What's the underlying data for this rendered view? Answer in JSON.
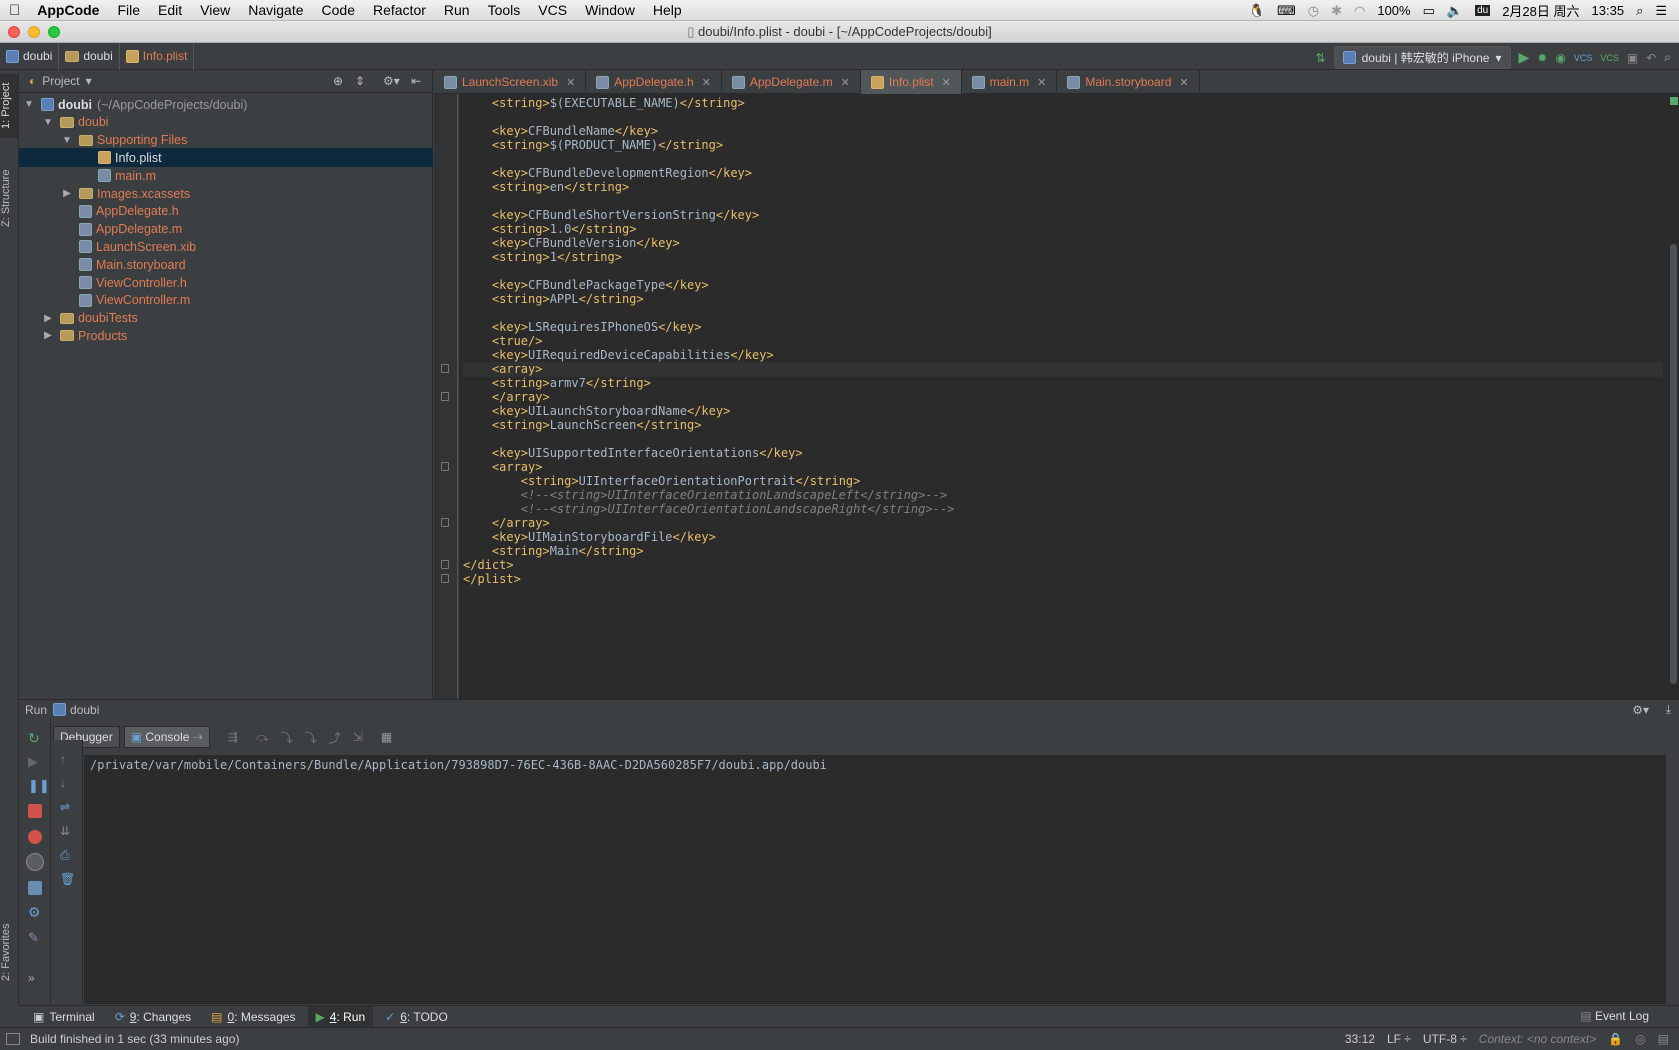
{
  "menubar": {
    "app": "AppCode",
    "items": [
      "File",
      "Edit",
      "View",
      "Navigate",
      "Code",
      "Refactor",
      "Run",
      "Tools",
      "VCS",
      "Window",
      "Help"
    ],
    "battery": "100%",
    "date": "2月28日 周六",
    "time": "13:35"
  },
  "window_title": "doubi/Info.plist - doubi - [~/AppCodeProjects/doubi]",
  "breadcrumbs": [
    "doubi",
    "doubi",
    "Info.plist"
  ],
  "run_config": "doubi | 韩宏敏的 iPhone",
  "vcs_labels": [
    "VCS",
    "VCS"
  ],
  "left_strip": {
    "project": "1: Project",
    "structure": "Z: Structure",
    "favorites": "2: Favorites"
  },
  "project_panel": {
    "header": "Project",
    "tree": [
      {
        "label": "doubi",
        "extra": "(~/AppCodeProjects/doubi)",
        "level": 0,
        "arrow": "▼",
        "icon": "proj",
        "color": "white"
      },
      {
        "label": "doubi",
        "level": 1,
        "arrow": "▼",
        "icon": "folder",
        "color": "orange"
      },
      {
        "label": "Supporting Files",
        "level": 2,
        "arrow": "▼",
        "icon": "folder",
        "color": "orange"
      },
      {
        "label": "Info.plist",
        "level": 3,
        "arrow": "",
        "icon": "plist",
        "color": "white",
        "selected": true
      },
      {
        "label": "main.m",
        "level": 3,
        "arrow": "",
        "icon": "m",
        "color": "orange"
      },
      {
        "label": "Images.xcassets",
        "level": 2,
        "arrow": "▶",
        "icon": "folder",
        "color": "orange"
      },
      {
        "label": "AppDelegate.h",
        "level": 2,
        "arrow": "",
        "icon": "m",
        "color": "orange"
      },
      {
        "label": "AppDelegate.m",
        "level": 2,
        "arrow": "",
        "icon": "m",
        "color": "orange"
      },
      {
        "label": "LaunchScreen.xib",
        "level": 2,
        "arrow": "",
        "icon": "m",
        "color": "orange"
      },
      {
        "label": "Main.storyboard",
        "level": 2,
        "arrow": "",
        "icon": "m",
        "color": "orange"
      },
      {
        "label": "ViewController.h",
        "level": 2,
        "arrow": "",
        "icon": "m",
        "color": "orange"
      },
      {
        "label": "ViewController.m",
        "level": 2,
        "arrow": "",
        "icon": "m",
        "color": "orange"
      },
      {
        "label": "doubiTests",
        "level": 1,
        "arrow": "▶",
        "icon": "folder",
        "color": "orange"
      },
      {
        "label": "Products",
        "level": 1,
        "arrow": "▶",
        "icon": "folder",
        "color": "orange"
      }
    ]
  },
  "editor_tabs": [
    {
      "label": "LaunchScreen.xib",
      "active": false
    },
    {
      "label": "AppDelegate.h",
      "active": false
    },
    {
      "label": "AppDelegate.m",
      "active": false
    },
    {
      "label": "Info.plist",
      "active": true
    },
    {
      "label": "main.m",
      "active": false
    },
    {
      "label": "Main.storyboard",
      "active": false
    }
  ],
  "code_lines": [
    {
      "indent": 1,
      "parts": [
        [
          "tag",
          "<string>"
        ],
        [
          "txt",
          "$(EXECUTABLE_NAME)"
        ],
        [
          "tag",
          "</string>"
        ]
      ]
    },
    {
      "indent": 0,
      "parts": []
    },
    {
      "indent": 1,
      "parts": [
        [
          "tag",
          "<key>"
        ],
        [
          "txt",
          "CFBundleName"
        ],
        [
          "tag",
          "</key>"
        ]
      ]
    },
    {
      "indent": 1,
      "parts": [
        [
          "tag",
          "<string>"
        ],
        [
          "txt",
          "$(PRODUCT_NAME)"
        ],
        [
          "tag",
          "</string>"
        ]
      ]
    },
    {
      "indent": 0,
      "parts": []
    },
    {
      "indent": 1,
      "parts": [
        [
          "tag",
          "<key>"
        ],
        [
          "txt",
          "CFBundleDevelopmentRegion"
        ],
        [
          "tag",
          "</key>"
        ]
      ]
    },
    {
      "indent": 1,
      "parts": [
        [
          "tag",
          "<string>"
        ],
        [
          "txt",
          "en"
        ],
        [
          "tag",
          "</string>"
        ]
      ]
    },
    {
      "indent": 0,
      "parts": []
    },
    {
      "indent": 1,
      "parts": [
        [
          "tag",
          "<key>"
        ],
        [
          "txt",
          "CFBundleShortVersionString"
        ],
        [
          "tag",
          "</key>"
        ]
      ]
    },
    {
      "indent": 1,
      "parts": [
        [
          "tag",
          "<string>"
        ],
        [
          "txt",
          "1.0"
        ],
        [
          "tag",
          "</string>"
        ]
      ]
    },
    {
      "indent": 1,
      "parts": [
        [
          "tag",
          "<key>"
        ],
        [
          "txt",
          "CFBundleVersion"
        ],
        [
          "tag",
          "</key>"
        ]
      ]
    },
    {
      "indent": 1,
      "parts": [
        [
          "tag",
          "<string>"
        ],
        [
          "txt",
          "1"
        ],
        [
          "tag",
          "</string>"
        ]
      ]
    },
    {
      "indent": 0,
      "parts": []
    },
    {
      "indent": 1,
      "parts": [
        [
          "tag",
          "<key>"
        ],
        [
          "txt",
          "CFBundlePackageType"
        ],
        [
          "tag",
          "</key>"
        ]
      ]
    },
    {
      "indent": 1,
      "parts": [
        [
          "tag",
          "<string>"
        ],
        [
          "txt",
          "APPL"
        ],
        [
          "tag",
          "</string>"
        ]
      ]
    },
    {
      "indent": 0,
      "parts": []
    },
    {
      "indent": 1,
      "parts": [
        [
          "tag",
          "<key>"
        ],
        [
          "txt",
          "LSRequiresIPhoneOS"
        ],
        [
          "tag",
          "</key>"
        ]
      ]
    },
    {
      "indent": 1,
      "parts": [
        [
          "tag",
          "<true/>"
        ]
      ]
    },
    {
      "indent": 1,
      "parts": [
        [
          "tag",
          "<key>"
        ],
        [
          "txt",
          "UIRequiredDeviceCapabilities"
        ],
        [
          "tag",
          "</key>"
        ]
      ]
    },
    {
      "indent": 1,
      "parts": [
        [
          "tag",
          "<array>"
        ]
      ],
      "highlight": true
    },
    {
      "indent": 1,
      "parts": [
        [
          "tag",
          "<string>"
        ],
        [
          "txt",
          "armv7"
        ],
        [
          "tag",
          "</string>"
        ]
      ]
    },
    {
      "indent": 1,
      "parts": [
        [
          "tag",
          "</array>"
        ]
      ]
    },
    {
      "indent": 1,
      "parts": [
        [
          "tag",
          "<key>"
        ],
        [
          "txt",
          "UILaunchStoryboardName"
        ],
        [
          "tag",
          "</key>"
        ]
      ]
    },
    {
      "indent": 1,
      "parts": [
        [
          "tag",
          "<string>"
        ],
        [
          "txt",
          "LaunchScreen"
        ],
        [
          "tag",
          "</string>"
        ]
      ]
    },
    {
      "indent": 0,
      "parts": []
    },
    {
      "indent": 1,
      "parts": [
        [
          "tag",
          "<key>"
        ],
        [
          "txt",
          "UISupportedInterfaceOrientations"
        ],
        [
          "tag",
          "</key>"
        ]
      ]
    },
    {
      "indent": 1,
      "parts": [
        [
          "tag",
          "<array>"
        ]
      ]
    },
    {
      "indent": 2,
      "parts": [
        [
          "tag",
          "<string>"
        ],
        [
          "txt",
          "UIInterfaceOrientationPortrait"
        ],
        [
          "tag",
          "</string>"
        ]
      ]
    },
    {
      "indent": 2,
      "parts": [
        [
          "cmt",
          "<!--<string>UIInterfaceOrientationLandscapeLeft</string>-->"
        ]
      ]
    },
    {
      "indent": 2,
      "parts": [
        [
          "cmt",
          "<!--<string>UIInterfaceOrientationLandscapeRight</string>-->"
        ]
      ]
    },
    {
      "indent": 1,
      "parts": [
        [
          "tag",
          "</array>"
        ]
      ]
    },
    {
      "indent": 1,
      "parts": [
        [
          "tag",
          "<key>"
        ],
        [
          "txt",
          "UIMainStoryboardFile"
        ],
        [
          "tag",
          "</key>"
        ]
      ]
    },
    {
      "indent": 1,
      "parts": [
        [
          "tag",
          "<string>"
        ],
        [
          "txt",
          "Main"
        ],
        [
          "tag",
          "</string>"
        ]
      ]
    },
    {
      "indent": 0,
      "parts": [
        [
          "tag",
          "</dict>"
        ]
      ]
    },
    {
      "indent": 0,
      "parts": [
        [
          "tag",
          "</plist>"
        ]
      ]
    }
  ],
  "run_panel": {
    "title": "Run",
    "config": "doubi",
    "tabs": [
      "Debugger",
      "Console"
    ],
    "console_line": "/private/var/mobile/Containers/Bundle/Application/793898D7-76EC-436B-8AAC-D2DA560285F7/doubi.app/doubi"
  },
  "bottom_tabs": [
    {
      "key": "",
      "label": "Terminal",
      "active": false
    },
    {
      "key": "9",
      "label": ": Changes",
      "active": false
    },
    {
      "key": "0",
      "label": ": Messages",
      "active": false
    },
    {
      "key": "4",
      "label": ": Run",
      "active": true
    },
    {
      "key": "6",
      "label": ": TODO",
      "active": false
    }
  ],
  "event_log": "Event Log",
  "status": {
    "message": "Build finished in 1 sec (33 minutes ago)",
    "position": "33:12",
    "line_sep": "LF ÷",
    "encoding": "UTF-8 ÷",
    "context": "Context: <no context>"
  },
  "colors": {
    "accent_orange": "#e07b53",
    "tag": "#e8bf6a",
    "run_green": "#59a869"
  }
}
